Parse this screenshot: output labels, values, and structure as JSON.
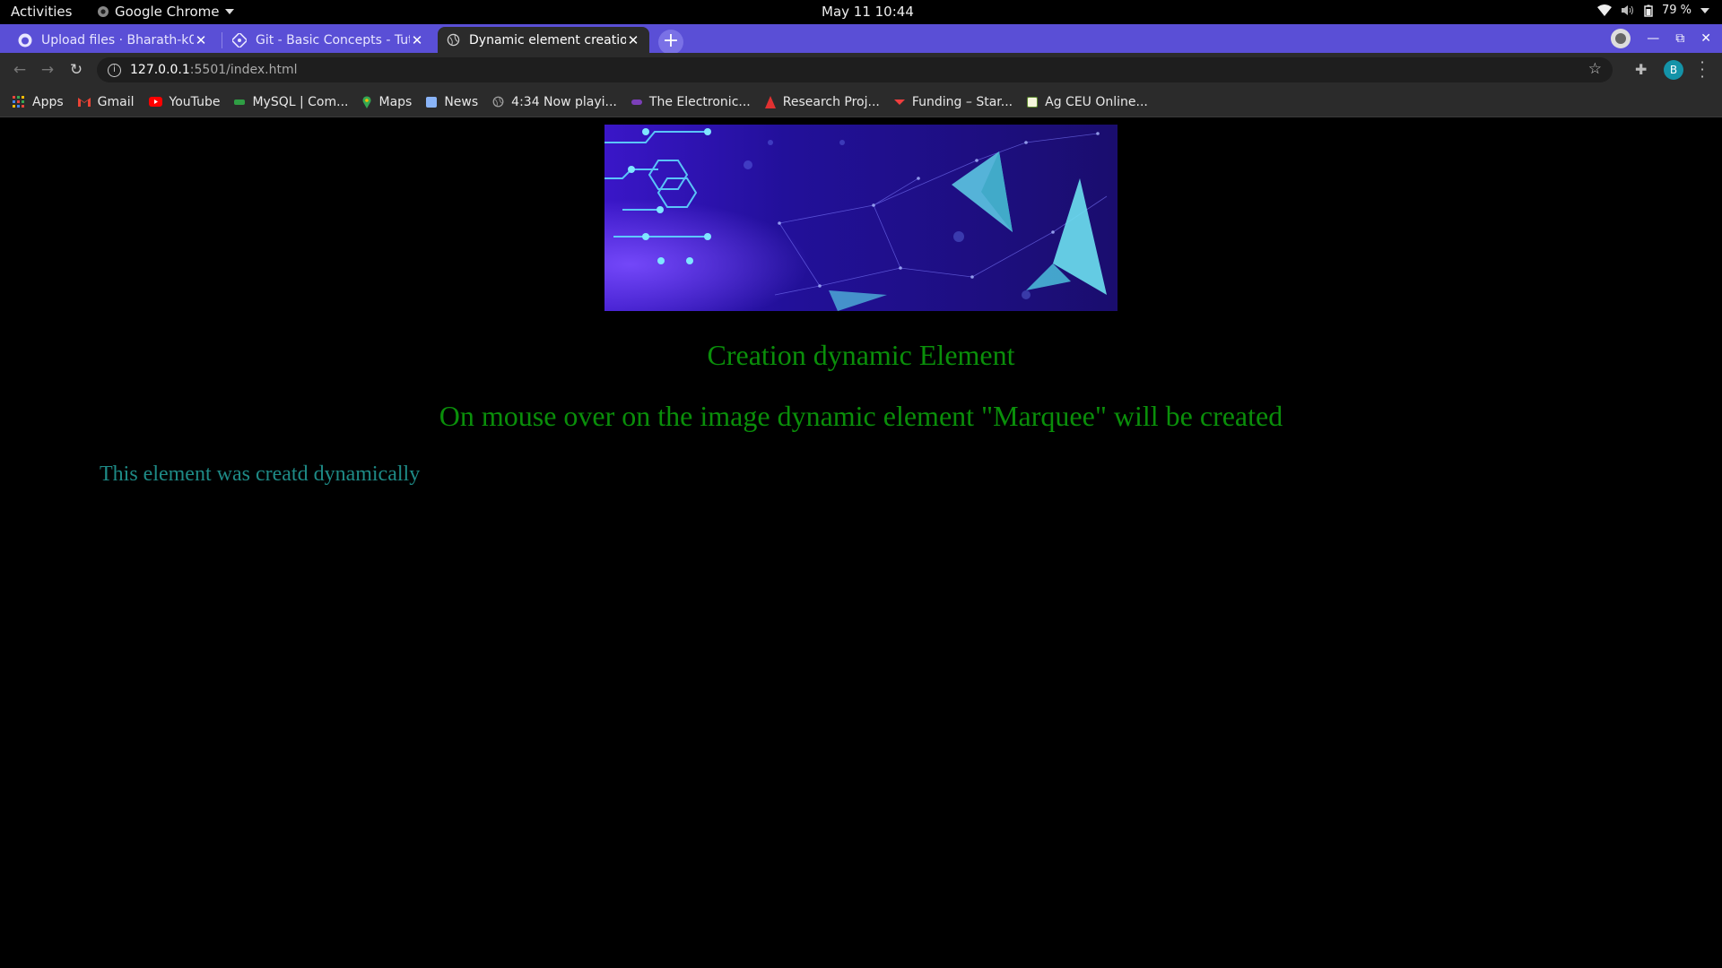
{
  "system": {
    "activities": "Activities",
    "app_name": "Google Chrome",
    "clock": "May 11  10:44",
    "battery": "79 %"
  },
  "tabs": [
    {
      "title": "Upload files · Bharath-k0",
      "icon": "github-icon",
      "active": false
    },
    {
      "title": "Git - Basic Concepts - Tuto",
      "icon": "git-site-icon",
      "active": false
    },
    {
      "title": "Dynamic element creation",
      "icon": "globe-icon",
      "active": true
    }
  ],
  "address": {
    "host": "127.0.0.1",
    "rest": ":5501/index.html"
  },
  "profile_initial": "B",
  "bookmarks": [
    {
      "label": "Apps",
      "icon": "apps-grid-icon",
      "color": "#e8453c"
    },
    {
      "label": "Gmail",
      "icon": "gmail-icon",
      "color": "#ea4335"
    },
    {
      "label": "YouTube",
      "icon": "youtube-icon",
      "color": "#ff0000"
    },
    {
      "label": "MySQL | Com...",
      "icon": "mysql-icon",
      "color": "#2f9e44"
    },
    {
      "label": "Maps",
      "icon": "maps-pin-icon",
      "color": "#34a853"
    },
    {
      "label": "News",
      "icon": "news-icon",
      "color": "#8ab4f8"
    },
    {
      "label": "4:34 Now playi...",
      "icon": "globe-icon",
      "color": "#9e9e9e"
    },
    {
      "label": "The Electronic...",
      "icon": "electronic-icon",
      "color": "#7b3fb8"
    },
    {
      "label": "Research Proj...",
      "icon": "research-icon",
      "color": "#e03131"
    },
    {
      "label": "Funding – Star...",
      "icon": "funding-icon",
      "color": "#f03e3e"
    },
    {
      "label": "Ag CEU Online...",
      "icon": "ag-ceu-icon",
      "color": "#f5f5dc"
    }
  ],
  "page": {
    "heading": "Creation dynamic Element",
    "subheading": "On mouse over on the image dynamic element \"Marquee\" will be created",
    "dynamic_text": "This element was creatd dynamically"
  },
  "colors": {
    "tab_strip": "#5a4fd6",
    "heading_green": "#0a8f0a",
    "dynamic_teal": "#1e8a86"
  }
}
